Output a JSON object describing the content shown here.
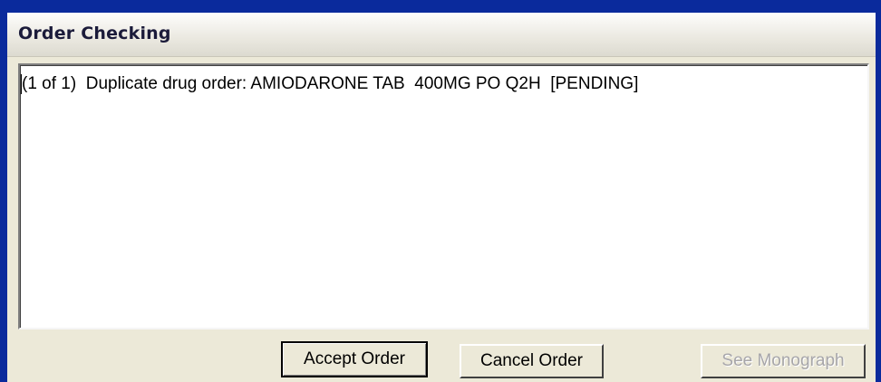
{
  "window": {
    "title": "Order Checking"
  },
  "message": {
    "text": "(1 of 1)  Duplicate drug order: AMIODARONE TAB  400MG PO Q2H  [PENDING]"
  },
  "buttons": {
    "accept_label": "Accept Order",
    "cancel_label": "Cancel Order",
    "monograph_label": "See Monograph",
    "monograph_enabled": false
  },
  "colors": {
    "desktop": "#0a2a9c",
    "dialog": "#ece9d8",
    "disabled_text": "#a7a6aa"
  }
}
